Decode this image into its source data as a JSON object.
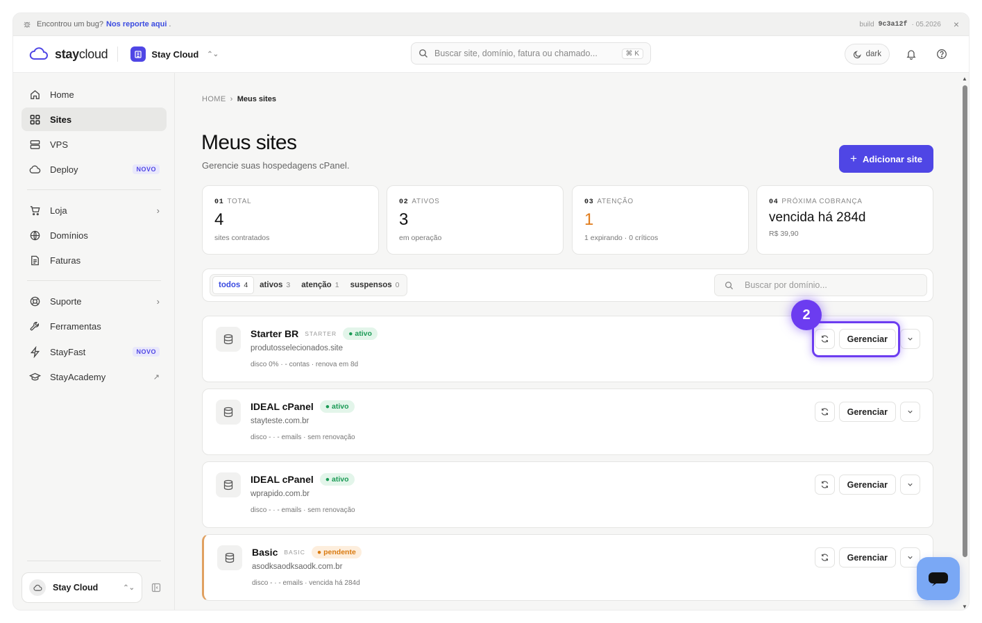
{
  "bugbar": {
    "text": "Encontrou um bug?",
    "link": "Nos reporte aqui",
    "link_suffix": ".",
    "build_label": "build",
    "build_hash": "9c3a12f",
    "build_date": "· 05.2026"
  },
  "header": {
    "logo_bold": "stay",
    "logo_rest": "cloud",
    "org_name": "Stay Cloud",
    "search_placeholder": "Buscar site, domínio, fatura ou chamado...",
    "search_shortcut": "⌘ K",
    "theme_label": "dark"
  },
  "sidebar": {
    "items": [
      {
        "label": "Home",
        "icon": "home-icon"
      },
      {
        "label": "Sites",
        "icon": "grid-icon",
        "active": true
      },
      {
        "label": "VPS",
        "icon": "server-icon"
      },
      {
        "label": "Deploy",
        "icon": "cloud-icon",
        "badge": "NOVO"
      },
      {
        "label": "Loja",
        "icon": "cart-icon",
        "chevron": "›"
      },
      {
        "label": "Domínios",
        "icon": "globe-icon"
      },
      {
        "label": "Faturas",
        "icon": "document-icon"
      },
      {
        "label": "Suporte",
        "icon": "lifebuoy-icon",
        "chevron": "›"
      },
      {
        "label": "Ferramentas",
        "icon": "wrench-icon"
      },
      {
        "label": "StayFast",
        "icon": "bolt-icon",
        "badge": "NOVO"
      },
      {
        "label": "StayAcademy",
        "icon": "graduation-cap-icon",
        "external": "↗"
      }
    ],
    "account_name": "Stay Cloud"
  },
  "main": {
    "breadcrumb_home": "HOME",
    "breadcrumb_sep": "›",
    "breadcrumb_current": "Meus sites",
    "title": "Meus sites",
    "subtitle": "Gerencie suas hospedagens cPanel.",
    "add_button": "Adicionar site",
    "stats": [
      {
        "num": "01",
        "label": "TOTAL",
        "value": "4",
        "note": "sites contratados"
      },
      {
        "num": "02",
        "label": "ATIVOS",
        "value": "3",
        "note": "em operação"
      },
      {
        "num": "03",
        "label": "ATENÇÃO",
        "value": "1",
        "note": "1 expirando · 0 críticos"
      },
      {
        "num": "04",
        "label": "PRÓXIMA COBRANÇA",
        "value": "vencida há 284d",
        "note": "R$ 39,90"
      }
    ],
    "tabs": [
      {
        "label": "todos",
        "count": "4",
        "active": true
      },
      {
        "label": "ativos",
        "count": "3"
      },
      {
        "label": "atenção",
        "count": "1"
      },
      {
        "label": "suspensos",
        "count": "0"
      }
    ],
    "filter_placeholder": "Buscar por domínio...",
    "step_badge": "2",
    "manage_label": "Gerenciar",
    "sites": [
      {
        "name": "Starter BR",
        "plan": "STARTER",
        "status": "ativo",
        "domain": "produtosselecionados.site",
        "meta": "disco 0%  ·  - contas  ·  renova em 8d"
      },
      {
        "name": "IDEAL cPanel",
        "plan": "",
        "status": "ativo",
        "domain": "stayteste.com.br",
        "meta": "disco -  ·  - emails  ·  sem renovação"
      },
      {
        "name": "IDEAL cPanel",
        "plan": "",
        "status": "ativo",
        "domain": "wprapido.com.br",
        "meta": "disco -  ·  - emails  ·  sem renovação"
      },
      {
        "name": "Basic",
        "plan": "BASIC",
        "status": "pendente",
        "domain": "asodksaodksaodk.com.br",
        "meta": "disco -  ·  - emails  ·  vencida há 284d"
      }
    ]
  },
  "colors": {
    "accent": "#4f46e5",
    "highlight": "#6c3cf0",
    "status_active": "#1a9a55",
    "status_pending": "#d97a10",
    "warning_value": "#e07b1a"
  }
}
